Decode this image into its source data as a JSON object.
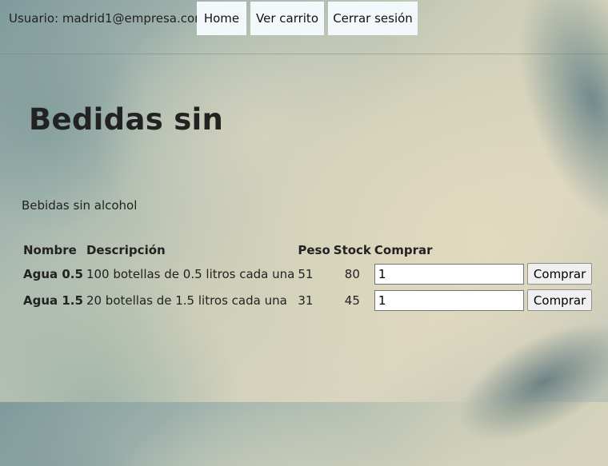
{
  "header": {
    "user_label": "Usuario: madrid1@empresa.com",
    "nav": {
      "home": "Home",
      "cart": "Ver carrito",
      "logout": "Cerrar sesión"
    }
  },
  "category": {
    "title": "Bedidas sin",
    "description": "Bebidas sin alcohol"
  },
  "table": {
    "headers": {
      "name": "Nombre",
      "description": "Descripción",
      "weight": "Peso",
      "stock": "Stock",
      "buy": "Comprar"
    },
    "rows": [
      {
        "name": "Agua 0.5",
        "description": "100 botellas de 0.5 litros cada una",
        "weight": "51",
        "stock": "80",
        "quantity": "1",
        "buy_label": "Comprar"
      },
      {
        "name": "Agua 1.5",
        "description": "20 botellas de 1.5 litros cada una",
        "weight": "31",
        "stock": "45",
        "quantity": "1",
        "buy_label": "Comprar"
      }
    ]
  }
}
